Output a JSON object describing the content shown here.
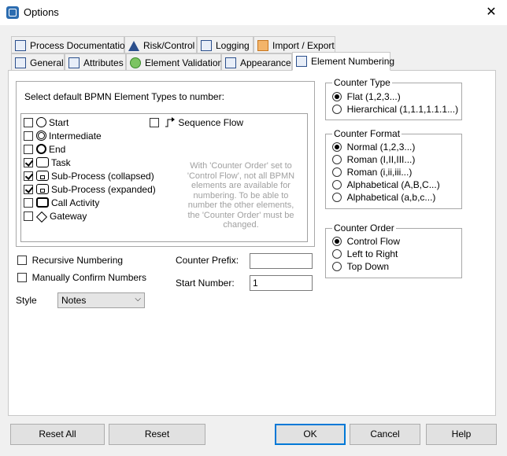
{
  "window": {
    "title": "Options",
    "close_glyph": "✕"
  },
  "tabs_row1": [
    {
      "label": "Process Documentation",
      "icon": "word-icon"
    },
    {
      "label": "Risk/Control",
      "icon": "warning-triangle-icon"
    },
    {
      "label": "Logging",
      "icon": "log-icon"
    },
    {
      "label": "Import / Export",
      "icon": "import-export-icon"
    }
  ],
  "tabs_row2": [
    {
      "label": "General",
      "icon": "general-icon"
    },
    {
      "label": "Attributes",
      "icon": "attributes-icon"
    },
    {
      "label": "Element Validation",
      "icon": "check-circle-icon"
    },
    {
      "label": "Appearance",
      "icon": "appearance-icon"
    },
    {
      "label": "Element Numbering",
      "icon": "numbering-icon",
      "active": true
    }
  ],
  "element_types": {
    "heading": "Select default BPMN Element Types to number:",
    "items": [
      {
        "label": "Start",
        "checked": false,
        "icon": "start-event-icon"
      },
      {
        "label": "Intermediate",
        "checked": false,
        "icon": "intermediate-event-icon"
      },
      {
        "label": "End",
        "checked": false,
        "icon": "end-event-icon"
      },
      {
        "label": "Task",
        "checked": true,
        "icon": "task-icon"
      },
      {
        "label": "Sub-Process (collapsed)",
        "checked": true,
        "icon": "subprocess-collapsed-icon"
      },
      {
        "label": "Sub-Process (expanded)",
        "checked": true,
        "icon": "subprocess-expanded-icon"
      },
      {
        "label": "Call Activity",
        "checked": false,
        "icon": "call-activity-icon"
      },
      {
        "label": "Gateway",
        "checked": false,
        "icon": "gateway-icon"
      }
    ],
    "sequence_flow": {
      "label": "Sequence Flow",
      "checked": false,
      "icon": "sequence-flow-icon"
    },
    "info_text": "With 'Counter Order' set to 'Control Flow', not all BPMN elements are available for numbering. To be able to number the other elements, the 'Counter Order' must be changed."
  },
  "options": {
    "recursive_numbering": {
      "label": "Recursive Numbering",
      "checked": false
    },
    "manually_confirm": {
      "label": "Manually Confirm Numbers",
      "checked": false
    },
    "style_label": "Style",
    "style_value": "Notes",
    "counter_prefix_label": "Counter Prefix:",
    "counter_prefix_value": "",
    "start_number_label": "Start Number:",
    "start_number_value": "1"
  },
  "counter_type": {
    "title": "Counter Type",
    "options": [
      {
        "label": "Flat (1,2,3...)",
        "selected": true
      },
      {
        "label": "Hierarchical (1,1.1,1.1.1...)",
        "selected": false
      }
    ]
  },
  "counter_format": {
    "title": "Counter Format",
    "options": [
      {
        "label": "Normal (1,2,3...)",
        "selected": true
      },
      {
        "label": "Roman (I,II,III...)",
        "selected": false
      },
      {
        "label": "Roman (i,ii,iii...)",
        "selected": false
      },
      {
        "label": "Alphabetical (A,B,C...)",
        "selected": false
      },
      {
        "label": "Alphabetical (a,b,c...)",
        "selected": false
      }
    ]
  },
  "counter_order": {
    "title": "Counter Order",
    "options": [
      {
        "label": "Control Flow",
        "selected": true
      },
      {
        "label": "Left to Right",
        "selected": false
      },
      {
        "label": "Top Down",
        "selected": false
      }
    ]
  },
  "buttons": {
    "reset_all": "Reset All",
    "reset": "Reset",
    "ok": "OK",
    "cancel": "Cancel",
    "help": "Help"
  },
  "colors": {
    "accent": "#0078d7",
    "info_text": "#a0a0a0"
  }
}
